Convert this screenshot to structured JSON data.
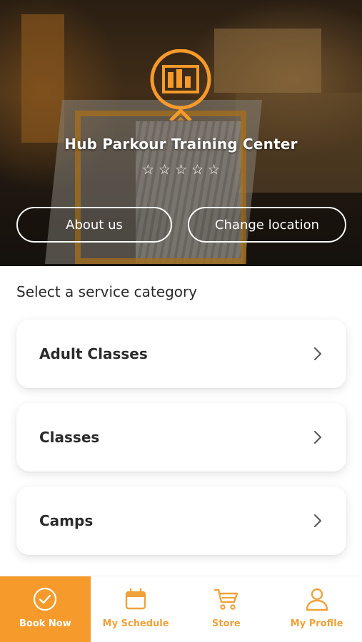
{
  "hero": {
    "title": "Hub Parkour Training Center",
    "rating_stars": "☆☆☆☆☆",
    "about_label": "About us",
    "change_location_label": "Change location"
  },
  "main": {
    "section_label": "Select a service category",
    "categories": [
      {
        "label": "Adult Classes"
      },
      {
        "label": "Classes"
      },
      {
        "label": "Camps"
      }
    ]
  },
  "nav": {
    "items": [
      {
        "label": "Book Now",
        "icon": "check-circle-icon",
        "active": true
      },
      {
        "label": "My Schedule",
        "icon": "calendar-icon",
        "active": false
      },
      {
        "label": "Store",
        "icon": "cart-icon",
        "active": false
      },
      {
        "label": "My Profile",
        "icon": "person-icon",
        "active": false
      }
    ]
  },
  "colors": {
    "accent": "#f59a2b",
    "accent_text": "#f0a23a",
    "card_text": "#2b2b2b"
  }
}
